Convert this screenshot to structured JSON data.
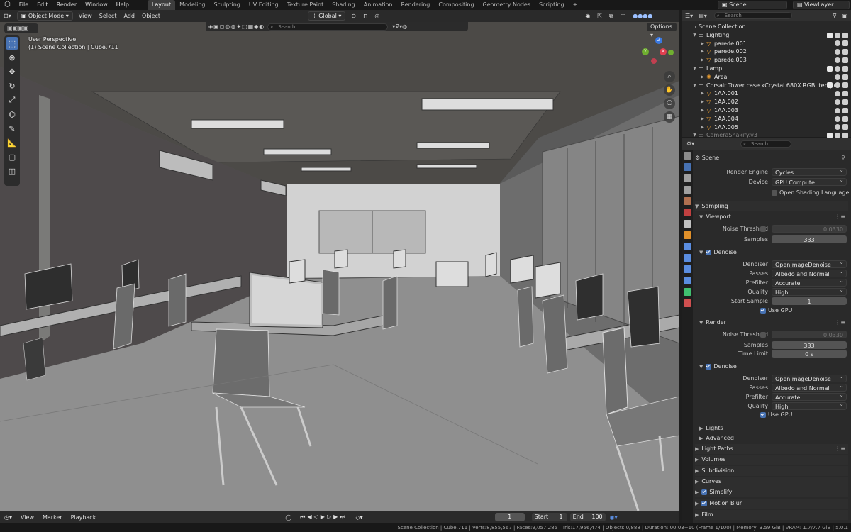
{
  "menu": [
    "File",
    "Edit",
    "Render",
    "Window",
    "Help"
  ],
  "workspaces": [
    "Layout",
    "Modeling",
    "Sculpting",
    "UV Editing",
    "Texture Paint",
    "Shading",
    "Animation",
    "Rendering",
    "Compositing",
    "Geometry Nodes",
    "Scripting"
  ],
  "active_workspace": "Layout",
  "top_right": {
    "scene": "Scene",
    "view_layer": "ViewLayer"
  },
  "viewport_header": {
    "mode": "Object Mode",
    "items": [
      "View",
      "Select",
      "Add",
      "Object"
    ],
    "orientation": "Global",
    "search_placeholder": "Search",
    "options": "Options"
  },
  "viewport_info": {
    "line1": "User Perspective",
    "line2": "(1) Scene Collection | Cube.711"
  },
  "gizmo": {
    "x": "X",
    "y": "Y",
    "z": "Z"
  },
  "outliner": {
    "search_placeholder": "Search",
    "rows": [
      {
        "label": "Scene Collection",
        "indent": 0,
        "icon": "scene-collection-icon",
        "color": "#e6e6e6",
        "flags": false
      },
      {
        "label": "Lighting",
        "indent": 1,
        "icon": "collection-icon",
        "color": "#e6e6e6",
        "flags": true
      },
      {
        "label": "parede.001",
        "indent": 2,
        "icon": "mesh-icon",
        "color": "#f0a030",
        "flags": true
      },
      {
        "label": "parede.002",
        "indent": 2,
        "icon": "mesh-icon",
        "color": "#f0a030",
        "flags": true
      },
      {
        "label": "parede.003",
        "indent": 2,
        "icon": "mesh-icon",
        "color": "#f0a030",
        "flags": true
      },
      {
        "label": "Lamp",
        "indent": 1,
        "icon": "collection-icon",
        "color": "#e6e6e6",
        "flags": true
      },
      {
        "label": "Area",
        "indent": 2,
        "icon": "light-icon",
        "color": "#f0a030",
        "flags": true
      },
      {
        "label": "Corsair Tower case »Crystal 680X RGB, temper",
        "indent": 1,
        "icon": "collection-icon",
        "color": "#e6e6e6",
        "flags": true
      },
      {
        "label": "1AA.001",
        "indent": 2,
        "icon": "mesh-icon",
        "color": "#f0a030",
        "flags": true
      },
      {
        "label": "1AA.002",
        "indent": 2,
        "icon": "mesh-icon",
        "color": "#f0a030",
        "flags": true
      },
      {
        "label": "1AA.003",
        "indent": 2,
        "icon": "mesh-icon",
        "color": "#f0a030",
        "flags": true
      },
      {
        "label": "1AA.004",
        "indent": 2,
        "icon": "mesh-icon",
        "color": "#f0a030",
        "flags": true
      },
      {
        "label": "1AA.005",
        "indent": 2,
        "icon": "mesh-icon",
        "color": "#f0a030",
        "flags": true
      },
      {
        "label": "CameraShakify.v3",
        "indent": 1,
        "icon": "collection-icon",
        "color": "#888888",
        "flags": true
      }
    ]
  },
  "properties": {
    "search_placeholder": "Search",
    "context": "Scene",
    "render_engine_label": "Render Engine",
    "render_engine": "Cycles",
    "device_label": "Device",
    "device": "GPU Compute",
    "osl_label": "Open Shading Language",
    "sampling": "Sampling",
    "viewport": "Viewport",
    "vp_noise_label": "Noise Threshold",
    "vp_noise": "0.0330",
    "vp_samples_label": "Samples",
    "vp_samples": "333",
    "vp_denoise": "Denoise",
    "vp_denoiser_label": "Denoiser",
    "vp_denoiser": "OpenImageDenoise",
    "vp_passes_label": "Passes",
    "vp_passes": "Albedo and Normal",
    "vp_prefilter_label": "Prefilter",
    "vp_prefilter": "Accurate",
    "vp_quality_label": "Quality",
    "vp_quality": "High",
    "vp_start_label": "Start Sample",
    "vp_start": "1",
    "vp_gpu": "Use GPU",
    "render": "Render",
    "r_noise_label": "Noise Threshold",
    "r_noise": "0.0330",
    "r_samples_label": "Samples",
    "r_samples": "333",
    "r_time_label": "Time Limit",
    "r_time": "0 s",
    "r_denoise": "Denoise",
    "r_denoiser_label": "Denoiser",
    "r_denoiser": "OpenImageDenoise",
    "r_passes_label": "Passes",
    "r_passes": "Albedo and Normal",
    "r_prefilter_label": "Prefilter",
    "r_prefilter": "Accurate",
    "r_quality_label": "Quality",
    "r_quality": "High",
    "r_gpu": "Use GPU",
    "lights": "Lights",
    "advanced": "Advanced",
    "light_paths": "Light Paths",
    "volumes": "Volumes",
    "subdivision": "Subdivision",
    "curves": "Curves",
    "simplify": "Simplify",
    "motion_blur": "Motion Blur",
    "film": "Film"
  },
  "timeline": {
    "items": [
      "View",
      "Marker",
      "Playback"
    ],
    "frame": "1",
    "start_label": "Start",
    "start": "1",
    "end_label": "End",
    "end": "100"
  },
  "status_bar": "Scene Collection | Cube.711 | Verts:8,855,567 | Faces:9,057,285 | Tris:17,956,474 | Objects:0/888 | Duration: 00:03+10 (Frame 1/100) | Memory: 3.59 GiB | VRAM: 1.7/7.7 GiB | 5.0.1"
}
